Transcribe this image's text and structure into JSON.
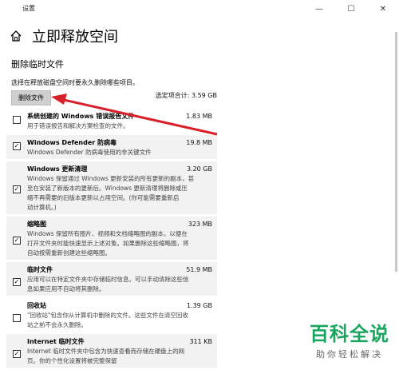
{
  "window": {
    "title": "设置"
  },
  "header": {
    "title": "立即释放空间"
  },
  "section": {
    "title": "删除临时文件",
    "description": "选择在释放磁盘空间时要永久删除哪些项目。",
    "delete_button": "删除文件",
    "total_label": "选定项合计: 3.59 GB"
  },
  "items": [
    {
      "name": "系统创建的 Windows 错误报告文件",
      "size": "1.83 MB",
      "checked": false,
      "desc": [
        "用于错误报告和解决方案检查的文件。"
      ]
    },
    {
      "name": "Windows Defender 防病毒",
      "size": "19.8 MB",
      "checked": true,
      "desc": [
        "Windows Defender 防病毒使用的非关键文件"
      ]
    },
    {
      "name": "Windows 更新清理",
      "size": "3.20 GB",
      "checked": true,
      "desc": [
        "Windows 保留通过 Windows 更新安装的所有更新的副本，甚",
        "至在安装了新版本的更新后。Windows 更新清理将删除或压",
        "缩不再需要的旧版本更新以占用空间。(你可能需要重新启",
        "动计算机。)"
      ]
    },
    {
      "name": "缩略图",
      "size": "323 MB",
      "checked": true,
      "desc": [
        "Windows 保留所有图片、视频和文档缩略图的副本，以便在",
        "打开文件夹时能快速显示上述对象。如果删除这些缩略图，将",
        "自动按需重新创建这些缩略图。"
      ]
    },
    {
      "name": "临时文件",
      "size": "51.9 MB",
      "checked": true,
      "desc": [
        "应用可以在特定文件夹中存储临时信息。可以手动清除这些信",
        "息如果应用不自动将其删除。"
      ]
    },
    {
      "name": "回收站",
      "size": "1.39 GB",
      "checked": false,
      "desc": [
        "\"回收站\"包含你从计算机中删除的文件。这些文件在清空回收",
        "站之前不会永久删除。"
      ]
    },
    {
      "name": "Internet 临时文件",
      "size": "311 KB",
      "checked": true,
      "desc": [
        "Internet 临时文件夹中包含为快速查看而存储在硬盘上的网",
        "页。你的个性化设置将被完整保留"
      ]
    }
  ],
  "watermark": {
    "logo": "百科全说",
    "sub": "助你轻松解决"
  },
  "colors": {
    "arrow": "#d9202a",
    "watermark_green": "#1aa55f",
    "checked_bg": "#f2f2f2"
  }
}
